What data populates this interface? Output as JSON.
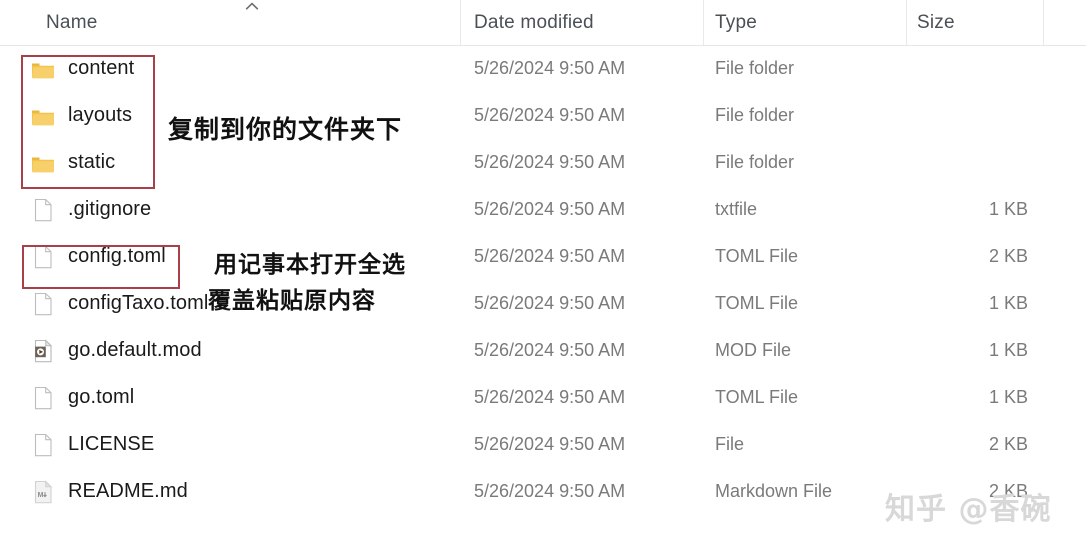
{
  "window": {
    "title": "File Explorer details view"
  },
  "columns": {
    "name": "Name",
    "date_modified": "Date modified",
    "type": "Type",
    "size": "Size",
    "sort_indicator": "chevron-up-icon"
  },
  "rows": [
    {
      "name": "content",
      "icon": "folder-icon",
      "date": "5/26/2024 9:50 AM",
      "type": "File folder",
      "size": ""
    },
    {
      "name": "layouts",
      "icon": "folder-icon",
      "date": "5/26/2024 9:50 AM",
      "type": "File folder",
      "size": ""
    },
    {
      "name": "static",
      "icon": "folder-icon",
      "date": "5/26/2024 9:50 AM",
      "type": "File folder",
      "size": ""
    },
    {
      "name": ".gitignore",
      "icon": "blank-file-icon",
      "date": "5/26/2024 9:50 AM",
      "type": "txtfile",
      "size": "1 KB"
    },
    {
      "name": "config.toml",
      "icon": "blank-file-icon",
      "date": "5/26/2024 9:50 AM",
      "type": "TOML File",
      "size": "2 KB"
    },
    {
      "name": "configTaxo.toml",
      "icon": "blank-file-icon",
      "date": "5/26/2024 9:50 AM",
      "type": "TOML File",
      "size": "1 KB"
    },
    {
      "name": "go.default.mod",
      "icon": "media-file-icon",
      "date": "5/26/2024 9:50 AM",
      "type": "MOD File",
      "size": "1 KB"
    },
    {
      "name": "go.toml",
      "icon": "blank-file-icon",
      "date": "5/26/2024 9:50 AM",
      "type": "TOML File",
      "size": "1 KB"
    },
    {
      "name": "LICENSE",
      "icon": "blank-file-icon",
      "date": "5/26/2024 9:50 AM",
      "type": "File",
      "size": "2 KB"
    },
    {
      "name": "README.md",
      "icon": "markdown-file-icon",
      "date": "5/26/2024 9:50 AM",
      "type": "Markdown File",
      "size": "2 KB"
    }
  ],
  "annotations": {
    "folders_note": "复制到你的文件夹下",
    "config_note_line1": "用记事本打开全选",
    "config_note_line2": "覆盖粘贴原内容",
    "highlight_color": "#a8404a"
  },
  "watermark": {
    "text": "知乎 @香碗"
  }
}
